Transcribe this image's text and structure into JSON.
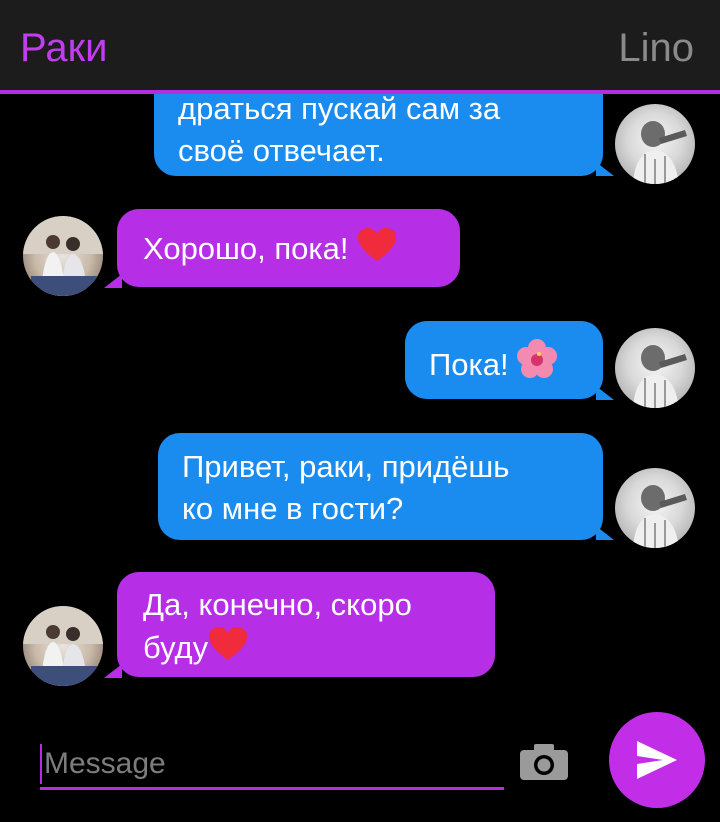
{
  "header": {
    "title": "Раки",
    "contact": "Lino"
  },
  "messages": [
    {
      "side": "out",
      "line1": "драться пускай сам за",
      "line2": "своё отвечает."
    },
    {
      "side": "in",
      "text": "Хорошо, пока!",
      "emoji": "heart"
    },
    {
      "side": "out",
      "text": "Пока!",
      "emoji": "hibiscus"
    },
    {
      "side": "out",
      "line1": "Привет, раки, придёшь",
      "line2": "ко мне в гости?"
    },
    {
      "side": "in",
      "line1": "Да, конечно, скоро",
      "line2": "буду",
      "emoji": "heart"
    }
  ],
  "input": {
    "placeholder": "Message",
    "camera_icon": "camera-icon",
    "send_icon": "send-icon"
  },
  "colors": {
    "accent": "#b22ee0",
    "outgoing": "#1a8cf0",
    "incoming": "#b62ee6",
    "background": "#000000"
  }
}
